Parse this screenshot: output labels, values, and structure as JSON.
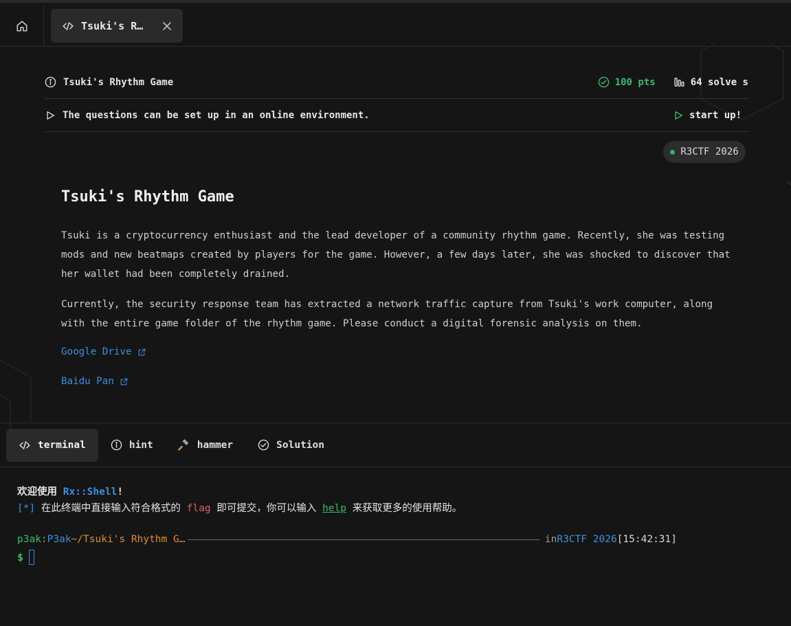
{
  "tab": {
    "title": "Tsuki's R…"
  },
  "challenge": {
    "name": "Tsuki's Rhythm Game",
    "points": "100 pts",
    "solves": "64 solve s",
    "env_note": "The questions can be set up in an online environment.",
    "start_label": "start up!",
    "event_badge": "R3CTF 2026",
    "title": "Tsuki's Rhythm Game",
    "paragraphs": [
      "Tsuki is a cryptocurrency enthusiast and the lead developer of a community rhythm game. Recently, she was testing mods and new beatmaps created by players for the game. However, a few days later, she was shocked to discover that her wallet had been completely drained.",
      "Currently, the security response team has extracted a network traffic capture from Tsuki's work computer, along with the entire game folder of the rhythm game. Please conduct a digital forensic analysis on them."
    ],
    "links": [
      "Google Drive",
      "Baidu Pan"
    ]
  },
  "bottom_tabs": [
    "terminal",
    "hint",
    "hammer",
    "Solution"
  ],
  "terminal": {
    "welcome_prefix": "欢迎使用 ",
    "shell_name": "Rx::Shell",
    "welcome_suffix": "!",
    "info_marker": "[*]",
    "info_a": " 在此终端中直接输入符合格式的 ",
    "info_flag": "flag",
    "info_b": " 即可提交，你可以输入 ",
    "info_help": "help",
    "info_c": " 来获取更多的使用帮助。",
    "user": "p3ak",
    "sep": ":",
    "host": "P3ak",
    "path": " ~/Tsuki's Rhythm G…",
    "in_label": "in ",
    "event": "R3CTF 2026",
    "time": " [15:42:31]",
    "prompt_symbol": "$"
  },
  "colors": {
    "accent_blue": "#3d8fe0",
    "success_green": "#3fb96a",
    "flag_red": "#e0625a",
    "path_orange": "#de8c3c"
  }
}
